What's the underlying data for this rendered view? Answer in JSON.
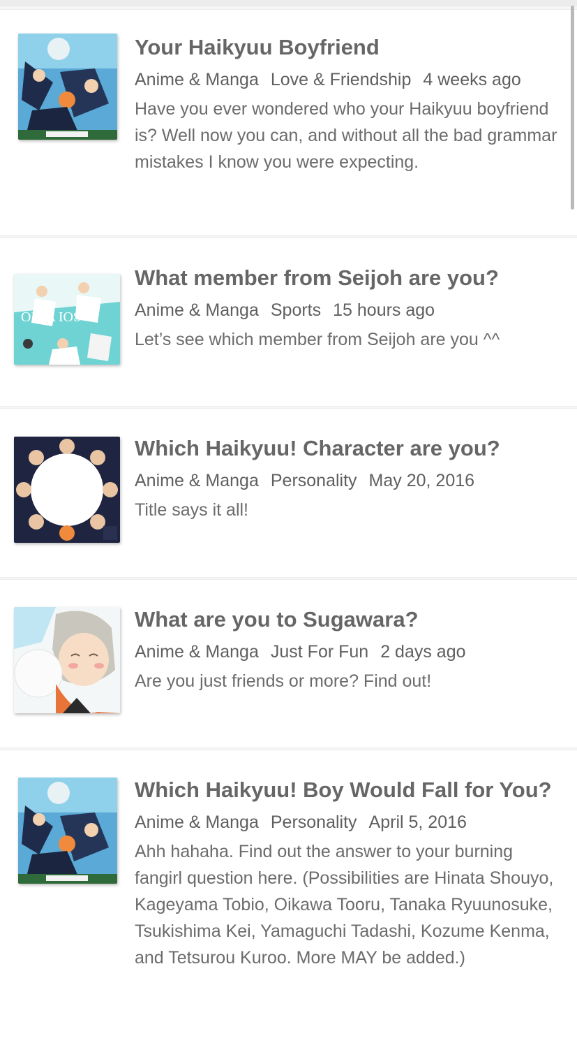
{
  "quizzes": [
    {
      "title": "Your Haikyuu Boyfriend",
      "category": "Anime & Manga",
      "tag": "Love & Friendship",
      "time": "4 weeks ago",
      "description": "Have you ever wondered who your Haikyuu boyfriend is? Well now you can, and without all the bad grammar mistakes I know you were expecting."
    },
    {
      "title": "What member from Seijoh are you?",
      "category": "Anime & Manga",
      "tag": "Sports",
      "time": "15 hours ago",
      "description": "Let’s see which member from Seijoh are you ^^"
    },
    {
      "title": "Which Haikyuu! Character are you?",
      "category": "Anime & Manga",
      "tag": "Personality",
      "time": "May 20, 2016",
      "description": "Title says it all!"
    },
    {
      "title": "What are you to Sugawara?",
      "category": "Anime & Manga",
      "tag": "Just For Fun",
      "time": "2 days ago",
      "description": "Are you just friends or more? Find out!"
    },
    {
      "title": "Which Haikyuu! Boy Would Fall for You?",
      "category": "Anime & Manga",
      "tag": "Personality",
      "time": "April 5, 2016",
      "description": "Ahh hahaha. Find out the answer to your burning fangirl question here. (Possibilities are Hinata Shouyo, Kageyama Tobio, Oikawa Tooru, Tanaka Ryuunosuke, Tsukishima Kei, Yamaguchi Tadashi, Kozume Kenma, and Tetsurou Kuroo. More MAY be added.)"
    }
  ],
  "thumbnails": [
    "haikyuu-team-poster-image",
    "seijoh-team-image",
    "team-huddle-circle-image",
    "sugawara-portrait-image",
    "haikyuu-team-poster-image"
  ]
}
